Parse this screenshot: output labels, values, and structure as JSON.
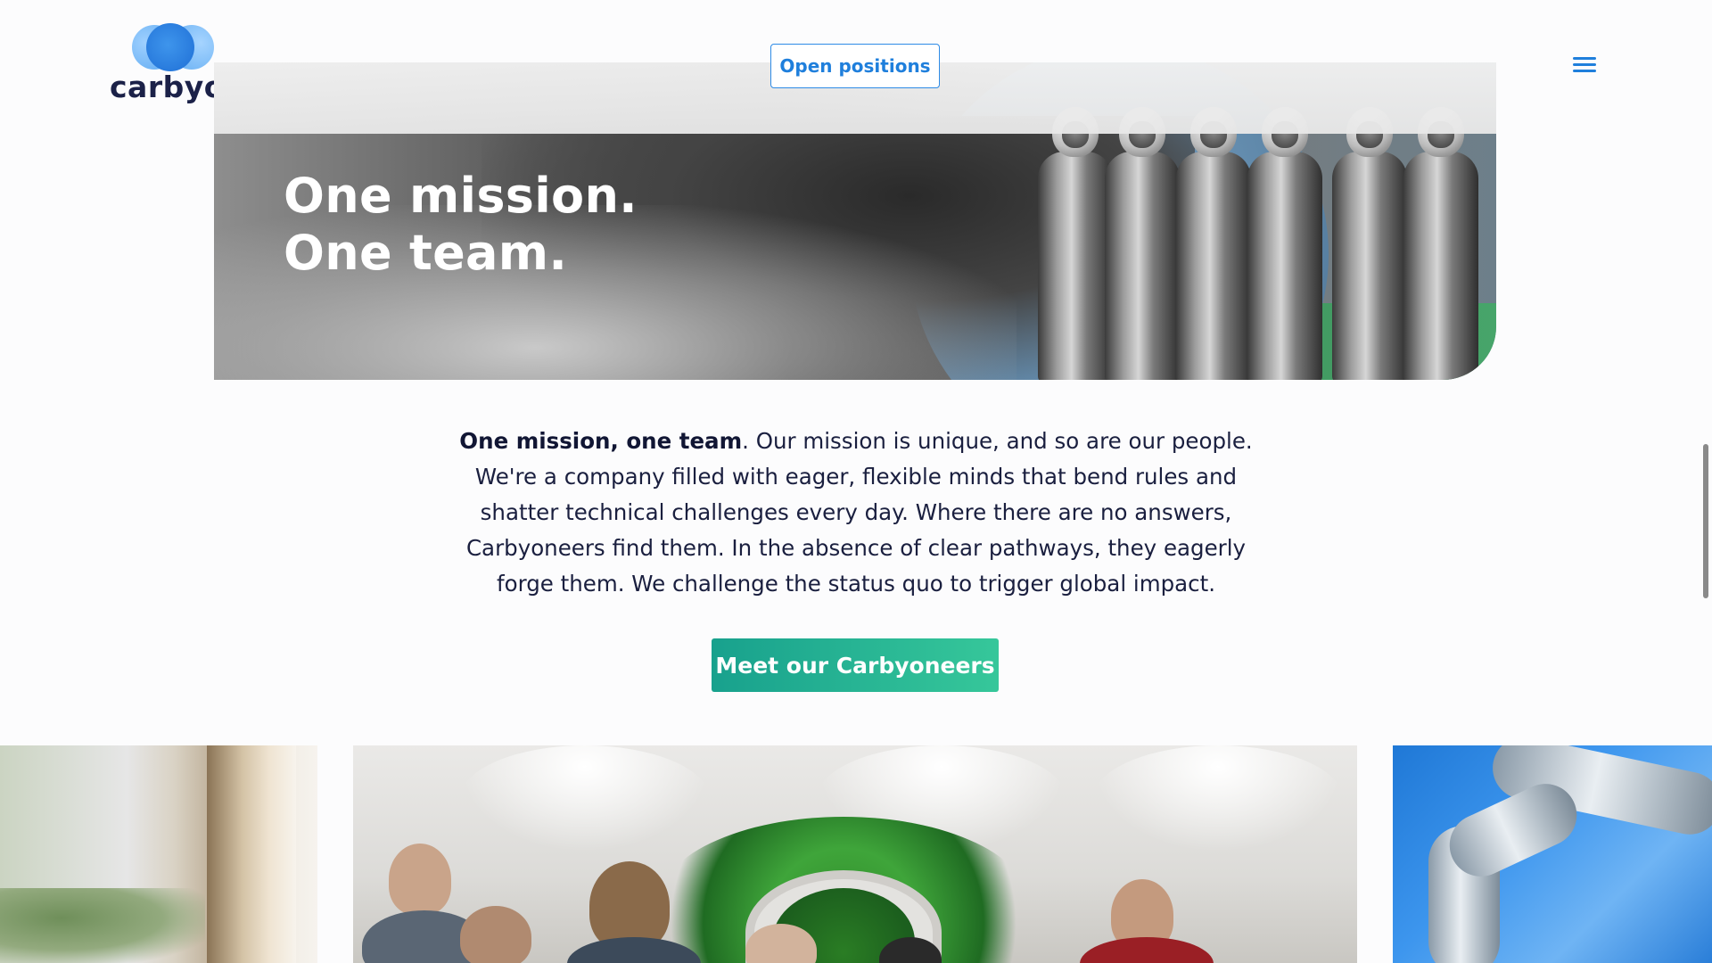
{
  "brand": {
    "name": "carbyon"
  },
  "header": {
    "open_positions_label": "Open positions",
    "menu_icon": "hamburger-menu-icon"
  },
  "hero": {
    "title_line1": "One mission.",
    "title_line2": "One team."
  },
  "intro": {
    "lead": "One mission, one team",
    "body": ". Our mission is unique, and so are our people. We're a company filled with eager, flexible minds that bend rules and shatter technical challenges every day. Where there are no answers, Carbyoneers find them. In the absence of clear pathways, they eagerly forge them. We challenge the status quo to trigger global impact."
  },
  "cta": {
    "label": "Meet our Carbyoneers"
  },
  "colors": {
    "accent_blue": "#1f7fdc",
    "cta_start": "#18a18d",
    "cta_end": "#36c79a",
    "text_dark": "#1a1f3f"
  }
}
